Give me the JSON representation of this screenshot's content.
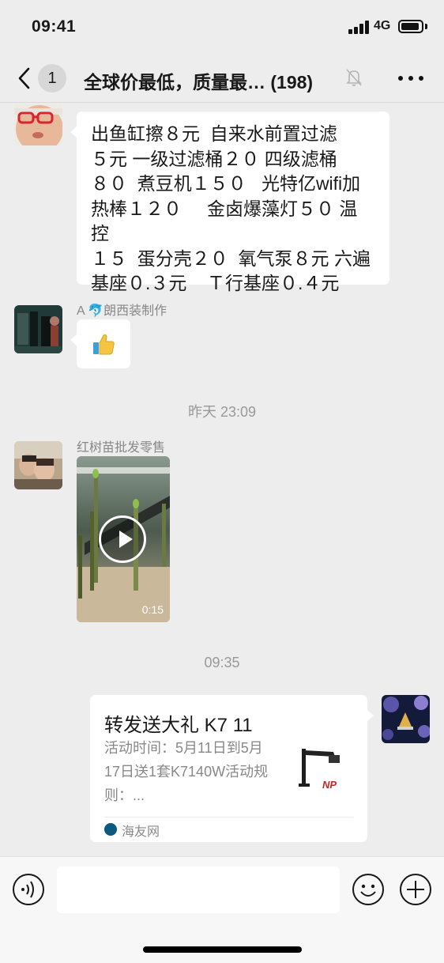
{
  "status_bar": {
    "time": "09:41",
    "network": "4G"
  },
  "nav": {
    "unread_count": "1",
    "title": "全球价最低，质量最… (198)"
  },
  "messages": [
    {
      "type": "text",
      "sender": "",
      "text": "出鱼缸擦８元  自来水前置过滤\n５元 一级过滤桶２０ 四级滤桶\n８０  煮豆机１５０   光特亿wifi加\n热棒１２０     金卤爆藻灯５０ 温控\n１５  蛋分壳２０  氧气泵８元 六遍\n基座０.３元    Ｔ行基座０.４元"
    },
    {
      "type": "sticker",
      "sender": "A 🐬朗西装制作",
      "sticker": "thumbs-up"
    },
    {
      "type": "timestamp",
      "text": "昨天 23:09"
    },
    {
      "type": "video",
      "sender": "红树苗批发零售",
      "duration": "0:15"
    },
    {
      "type": "timestamp",
      "text": "09:35"
    },
    {
      "type": "link_card",
      "title": "转发送大礼 K7 11",
      "description": "活动时间：5月11日到5月17日送1套K7140W活动规则：...",
      "source": "海友网"
    }
  ],
  "colors": {
    "background": "#ededed",
    "bubble": "#ffffff",
    "muted_text": "#888888",
    "accent": "#07c160"
  },
  "icons": [
    "back-icon",
    "mute-icon",
    "more-icon",
    "voice-icon",
    "emoji-icon",
    "plus-icon",
    "play-icon"
  ]
}
